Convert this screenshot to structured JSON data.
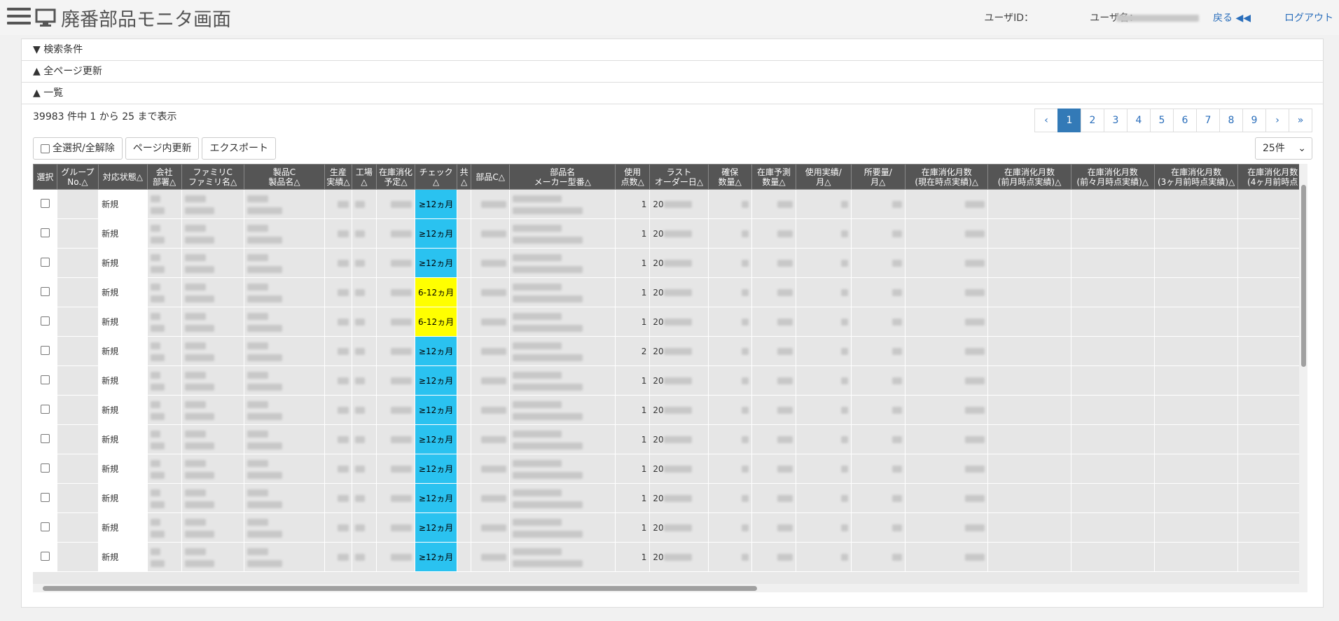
{
  "header": {
    "title": "廃番部品モニタ画面",
    "user_id_label": "ユーザID：",
    "user_name_label": "ユーザ名：",
    "back_label": "戻る ◀◀",
    "logout_label": "ログアウト"
  },
  "sections": {
    "search": "▼ 検索条件",
    "refresh_all": "▲ 全ページ更新",
    "list": "▲ 一覧"
  },
  "summary": "39983 件中 1 から 25 まで表示",
  "pagination": [
    "‹",
    "1",
    "2",
    "3",
    "4",
    "5",
    "6",
    "7",
    "8",
    "9",
    "›",
    "»"
  ],
  "buttons": {
    "select_all": "全選択/全解除",
    "page_refresh": "ページ内更新",
    "export": "エクスポート"
  },
  "page_size": "25件",
  "columns": [
    "選択",
    "グループ\nNo.△",
    "対応状態△",
    "会社\n部署△",
    "ファミリC\nファミリ名△",
    "製品C\n製品名△",
    "生産\n実績△",
    "工場\n△",
    "在庫消化\n予定△",
    "チェック\n△",
    "共\n△",
    "部品C△",
    "部品名\nメーカー型番△",
    "使用\n点数△",
    "ラスト\nオーダー日△",
    "確保\n数量△",
    "在庫予測\n数量△",
    "使用実績/\n月△",
    "所要量/\n月△",
    "在庫消化月数\n(現在時点実績)△",
    "在庫消化月数\n(前月時点実績)△",
    "在庫消化月数\n(前々月時点実績)△",
    "在庫消化月数\n(3ヶ月前時点実績)△",
    "在庫消化月数\n(4ヶ月前時点"
  ],
  "rows": [
    {
      "status": "新規",
      "check": "≥12ヵ月",
      "check_color": "blue",
      "points": "1",
      "order": "20"
    },
    {
      "status": "新規",
      "check": "≥12ヵ月",
      "check_color": "blue",
      "points": "1",
      "order": "20"
    },
    {
      "status": "新規",
      "check": "≥12ヵ月",
      "check_color": "blue",
      "points": "1",
      "order": "20"
    },
    {
      "status": "新規",
      "check": "6-12ヵ月",
      "check_color": "yellow",
      "points": "1",
      "order": "20"
    },
    {
      "status": "新規",
      "check": "6-12ヵ月",
      "check_color": "yellow",
      "points": "1",
      "order": "20"
    },
    {
      "status": "新規",
      "check": "≥12ヵ月",
      "check_color": "blue",
      "points": "2",
      "order": "20"
    },
    {
      "status": "新規",
      "check": "≥12ヵ月",
      "check_color": "blue",
      "points": "1",
      "order": "20"
    },
    {
      "status": "新規",
      "check": "≥12ヵ月",
      "check_color": "blue",
      "points": "1",
      "order": "20"
    },
    {
      "status": "新規",
      "check": "≥12ヵ月",
      "check_color": "blue",
      "points": "1",
      "order": "20"
    },
    {
      "status": "新規",
      "check": "≥12ヵ月",
      "check_color": "blue",
      "points": "1",
      "order": "20"
    },
    {
      "status": "新規",
      "check": "≥12ヵ月",
      "check_color": "blue",
      "points": "1",
      "order": "20"
    },
    {
      "status": "新規",
      "check": "≥12ヵ月",
      "check_color": "blue",
      "points": "1",
      "order": "20"
    },
    {
      "status": "新規",
      "check": "≥12ヵ月",
      "check_color": "blue",
      "points": "1",
      "order": "20"
    }
  ]
}
